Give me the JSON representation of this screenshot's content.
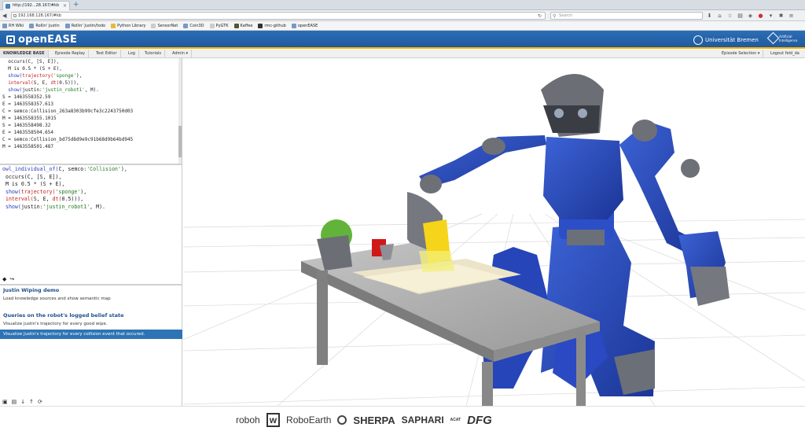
{
  "browser": {
    "tab_title": "http://192...28.167/#kb",
    "tab_close": "×",
    "new_tab": "+",
    "url": "192.168.128.167/#kb",
    "search_placeholder": "Search",
    "icons": [
      "download-icon",
      "home-icon",
      "star-icon",
      "bookmark-icon",
      "stop-icon",
      "chevron-down-icon",
      "menu-icon"
    ]
  },
  "bookmarks": [
    "RH Wiki",
    "Rollin' Justin",
    "Rollin' Justin/todo",
    "Python Library",
    "SensorNet",
    "Coin3D",
    "PyGTK",
    "Kaffee",
    "rmc-github",
    "openEASE"
  ],
  "header": {
    "app_name": "openEASE",
    "university": "Universität Bremen",
    "ai_label": "Artificial Intelligence"
  },
  "menu": {
    "left": [
      "KNOWLEDGE BASE",
      "Episode Replay",
      "Text Editor",
      "Log",
      "Tutorials",
      "Admin ▾"
    ],
    "right": [
      "Episode Selection ▾",
      "Logout feld_da"
    ]
  },
  "console_lines": [
    [
      {
        "t": "  occurs(C, [S, E]),",
        "c": ""
      }
    ],
    [
      {
        "t": "  M is 0.5 * (S + E),",
        "c": ""
      }
    ],
    [
      {
        "t": "  show(",
        "c": "k-blue"
      },
      {
        "t": "trajectory(",
        "c": "k-red"
      },
      {
        "t": "'sponge'",
        "c": "k-str"
      },
      {
        "t": "),",
        "c": ""
      }
    ],
    [
      {
        "t": "  interval(",
        "c": "k-red"
      },
      {
        "t": "S, E, ",
        "c": ""
      },
      {
        "t": "dt(",
        "c": "k-red"
      },
      {
        "t": "0.5",
        "c": ""
      },
      {
        "t": "))),",
        "c": ""
      }
    ],
    [
      {
        "t": "  show(",
        "c": "k-blue"
      },
      {
        "t": "justin:",
        "c": ""
      },
      {
        "t": "'justin_robot1'",
        "c": "k-str"
      },
      {
        "t": ", M).",
        "c": ""
      }
    ],
    [
      {
        "t": "S = 1463558352.59",
        "c": ""
      }
    ],
    [
      {
        "t": "E = 1463558357.613",
        "c": ""
      }
    ],
    [
      {
        "t": "C = semco:Collision_263a8303b99cfe3c2243750d03",
        "c": ""
      }
    ],
    [
      {
        "t": "M = 1463558355.1015",
        "c": ""
      }
    ],
    [
      {
        "t": "S = 1463558498.32",
        "c": ""
      }
    ],
    [
      {
        "t": "E = 1463558504.654",
        "c": ""
      }
    ],
    [
      {
        "t": "C = semco:Collision_bd75d8d9e9c91b68d9b64bd945",
        "c": ""
      }
    ],
    [
      {
        "t": "M = 1463558501.487",
        "c": ""
      }
    ]
  ],
  "query_lines": [
    [
      {
        "t": "owl_individual_of(",
        "c": "k-blue"
      },
      {
        "t": "C, semco:",
        "c": ""
      },
      {
        "t": "'Collision'",
        "c": "k-str"
      },
      {
        "t": "),",
        "c": ""
      }
    ],
    [
      {
        "t": " occurs(C, [S, E]),",
        "c": ""
      }
    ],
    [
      {
        "t": " M is 0.5 * (S + E),",
        "c": ""
      }
    ],
    [
      {
        "t": " show(",
        "c": "k-blue"
      },
      {
        "t": "trajectory(",
        "c": "k-red"
      },
      {
        "t": "'sponge'",
        "c": "k-str"
      },
      {
        "t": "),",
        "c": ""
      }
    ],
    [
      {
        "t": " interval(",
        "c": "k-red"
      },
      {
        "t": "S, E, ",
        "c": ""
      },
      {
        "t": "dt(",
        "c": "k-red"
      },
      {
        "t": "0.5",
        "c": ""
      },
      {
        "t": "))),",
        "c": ""
      }
    ],
    [
      {
        "t": " show(",
        "c": "k-blue"
      },
      {
        "t": "justin:",
        "c": ""
      },
      {
        "t": "'justin_robot1'",
        "c": "k-str"
      },
      {
        "t": ", M).",
        "c": ""
      }
    ]
  ],
  "query_tools": [
    "help-icon",
    "share-icon"
  ],
  "library": {
    "demo_title": "Justin Wiping demo",
    "demo_item": "Load knowledge sources and show semantic map",
    "section_title": "Queries on the robot's logged belief state",
    "items": [
      "Visualize Justin's trajectory for every good wipe.",
      "Visualize Justin's trajectory for every collision event that occured."
    ]
  },
  "bottom_tools": [
    "copy-icon",
    "paste-icon",
    "arrow-down-icon",
    "arrow-up-icon",
    "refresh-icon"
  ],
  "footer_logos": [
    "roboh",
    "w",
    "RoboEarth",
    "SHERPA",
    "SAPHARI",
    "ACAT",
    "DFG"
  ]
}
